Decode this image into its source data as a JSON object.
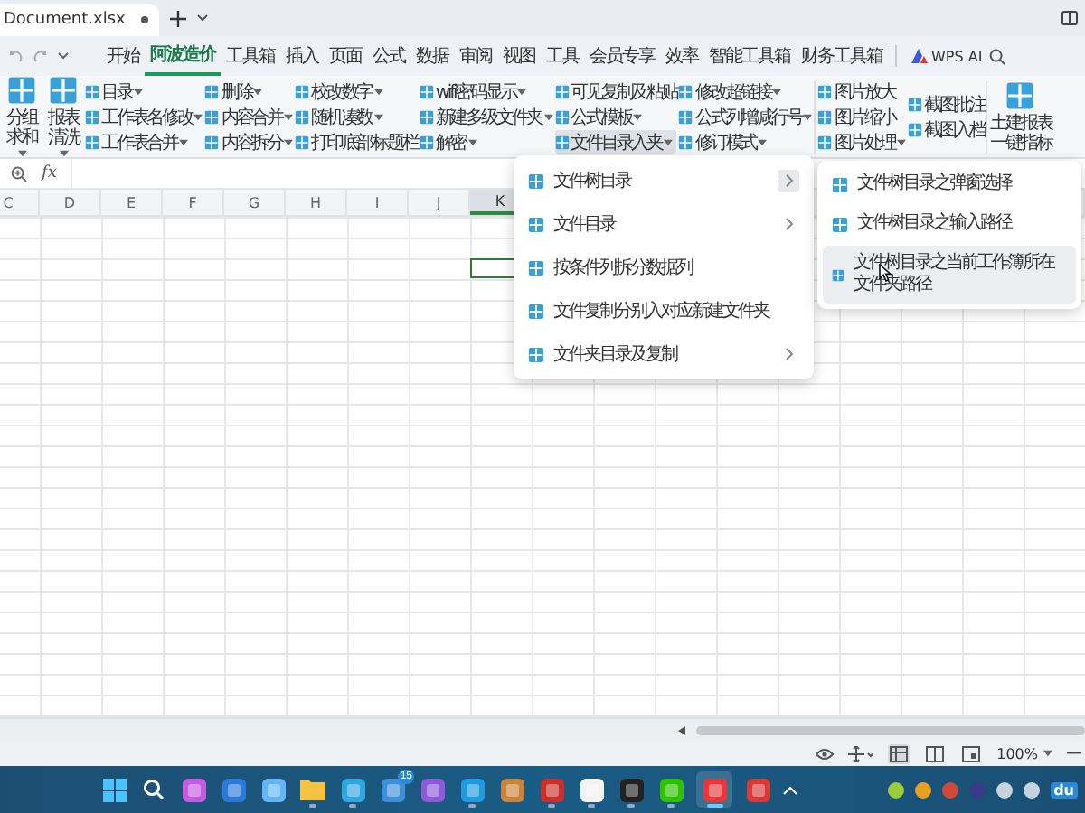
{
  "file_tab": {
    "title": "Document.xlsx"
  },
  "menu_tabs": [
    {
      "label": "开始",
      "selected": false
    },
    {
      "label": "阿波造价",
      "selected": true
    },
    {
      "label": "工具箱",
      "selected": false
    },
    {
      "label": "插入",
      "selected": false
    },
    {
      "label": "页面",
      "selected": false
    },
    {
      "label": "公式",
      "selected": false
    },
    {
      "label": "数据",
      "selected": false
    },
    {
      "label": "审阅",
      "selected": false
    },
    {
      "label": "视图",
      "selected": false
    },
    {
      "label": "工具",
      "selected": false
    },
    {
      "label": "会员专享",
      "selected": false
    },
    {
      "label": "效率",
      "selected": false
    },
    {
      "label": "智能工具箱",
      "selected": false
    },
    {
      "label": "财务工具箱",
      "selected": false
    }
  ],
  "wps_ai": "WPS AI",
  "ribbon": {
    "groups": [
      {
        "kind": "large",
        "buttons": [
          {
            "label": "分组求和",
            "dropdown": true
          },
          {
            "label": "报表清洗",
            "dropdown": true
          }
        ]
      },
      {
        "kind": "stack",
        "buttons": [
          {
            "label": "目录",
            "dropdown": true,
            "pressed": false
          },
          {
            "label": "工作表名修改",
            "dropdown": true,
            "pressed": false
          },
          {
            "label": "工作表合并",
            "dropdown": true,
            "pressed": false
          }
        ]
      },
      {
        "kind": "stack",
        "buttons": [
          {
            "label": "删除",
            "dropdown": true,
            "pressed": false
          },
          {
            "label": "内容合并",
            "dropdown": true,
            "pressed": false
          },
          {
            "label": "内容拆分",
            "dropdown": true,
            "pressed": false
          }
        ]
      },
      {
        "kind": "stack",
        "buttons": [
          {
            "label": "校改数字",
            "dropdown": true,
            "pressed": false
          },
          {
            "label": "随机凑数",
            "dropdown": true,
            "pressed": false
          },
          {
            "label": "打印底部标题栏",
            "dropdown": false,
            "pressed": false
          }
        ]
      },
      {
        "kind": "stack",
        "buttons": [
          {
            "label": "wifi密码显示",
            "dropdown": true,
            "pressed": false
          },
          {
            "label": "新建多级文件夹",
            "dropdown": true,
            "pressed": false
          },
          {
            "label": "解密",
            "dropdown": true,
            "pressed": false
          }
        ]
      },
      {
        "kind": "stack",
        "buttons": [
          {
            "label": "可见复制及粘贴",
            "dropdown": false,
            "pressed": false
          },
          {
            "label": "公式模板",
            "dropdown": true,
            "pressed": false
          },
          {
            "label": "文件目录入夹",
            "dropdown": true,
            "pressed": true
          }
        ]
      },
      {
        "kind": "stack",
        "buttons": [
          {
            "label": "修改超链接",
            "dropdown": true,
            "pressed": false
          },
          {
            "label": "公式列增减行号",
            "dropdown": true,
            "pressed": false
          },
          {
            "label": "修订模式",
            "dropdown": true,
            "pressed": false
          }
        ]
      },
      {
        "kind": "separator"
      },
      {
        "kind": "stack",
        "buttons": [
          {
            "label": "图片放大",
            "dropdown": false,
            "pressed": false
          },
          {
            "label": "图片缩小",
            "dropdown": false,
            "pressed": false
          },
          {
            "label": "图片处理",
            "dropdown": true,
            "pressed": false
          }
        ]
      },
      {
        "kind": "stack",
        "buttons": [
          {
            "label": "截图批注",
            "dropdown": false,
            "pressed": false
          },
          {
            "label": "截图入档",
            "dropdown": false,
            "pressed": false
          }
        ]
      },
      {
        "kind": "separator"
      },
      {
        "kind": "large",
        "buttons": [
          {
            "label": "土建报表一键指标",
            "dropdown": false
          }
        ]
      }
    ]
  },
  "formula_bar": {
    "function_label": "fx"
  },
  "columns": [
    {
      "label": "C",
      "selected": false
    },
    {
      "label": "D",
      "selected": false
    },
    {
      "label": "E",
      "selected": false
    },
    {
      "label": "F",
      "selected": false
    },
    {
      "label": "G",
      "selected": false
    },
    {
      "label": "H",
      "selected": false
    },
    {
      "label": "I",
      "selected": false
    },
    {
      "label": "J",
      "selected": false
    },
    {
      "label": "K",
      "selected": true
    }
  ],
  "menu": {
    "items": [
      {
        "label": "文件树目录",
        "submenu": true,
        "highlighted": true
      },
      {
        "label": "文件目录",
        "submenu": true,
        "highlighted": false
      },
      {
        "label": "按条件列拆分数据列",
        "submenu": false,
        "highlighted": false
      },
      {
        "label": "文件复制分别入对应新建文件夹",
        "submenu": false,
        "highlighted": false
      },
      {
        "label": "文件夹目录及复制",
        "submenu": true,
        "highlighted": false
      }
    ]
  },
  "submenu": {
    "items": [
      {
        "label": "文件树目录之弹窗选择",
        "hovered": false
      },
      {
        "label": "文件树目录之输入路径",
        "hovered": false
      },
      {
        "label": "文件树目录之当前工作簿所在文件夹路径",
        "hovered": true
      }
    ]
  },
  "status_bar": {
    "views": [
      {
        "kind": "normal",
        "selected": true
      },
      {
        "kind": "split",
        "selected": false
      },
      {
        "kind": "page",
        "selected": false
      }
    ],
    "zoom": "100%"
  },
  "taskbar": {
    "apps": [
      {
        "kind": "windows",
        "color": "#4cc2ff",
        "running": false,
        "active": false
      },
      {
        "kind": "search",
        "color": "#ffffff",
        "running": false,
        "active": false
      },
      {
        "kind": "app",
        "color": "#c45ce0",
        "running": false,
        "active": false
      },
      {
        "kind": "app",
        "color": "#2a7ad6",
        "running": false,
        "active": false
      },
      {
        "kind": "app",
        "color": "#64b5f6",
        "running": false,
        "active": false
      },
      {
        "kind": "folder",
        "color": "#f5c242",
        "running": true,
        "active": false
      },
      {
        "kind": "app",
        "color": "#2fa7e0",
        "running": true,
        "active": false
      },
      {
        "kind": "app",
        "color": "#3f8fd8",
        "running": false,
        "active": false,
        "badge": "15"
      },
      {
        "kind": "app",
        "color": "#8e5ad8",
        "running": false,
        "active": false
      },
      {
        "kind": "app",
        "color": "#1e9be0",
        "running": true,
        "active": false
      },
      {
        "kind": "app",
        "color": "#c8843a",
        "running": false,
        "active": false
      },
      {
        "kind": "app",
        "color": "#c9302c",
        "running": true,
        "active": false
      },
      {
        "kind": "app",
        "color": "#f2f2f2",
        "running": true,
        "active": false
      },
      {
        "kind": "app",
        "color": "#222222",
        "running": true,
        "active": false
      },
      {
        "kind": "app",
        "color": "#2dc100",
        "running": true,
        "active": false
      },
      {
        "kind": "app",
        "color": "#e8383d",
        "running": true,
        "active": true
      },
      {
        "kind": "app",
        "color": "#d83a3a",
        "running": false,
        "active": false
      }
    ],
    "tray": [
      {
        "color": "#9ccc3a"
      },
      {
        "color": "#e8a020"
      },
      {
        "color": "#d04a3a"
      },
      {
        "color": "#3a3a8a"
      },
      {
        "color": "#c8d2dc"
      },
      {
        "color": "#c8d2dc"
      }
    ],
    "tray_label": "du"
  }
}
